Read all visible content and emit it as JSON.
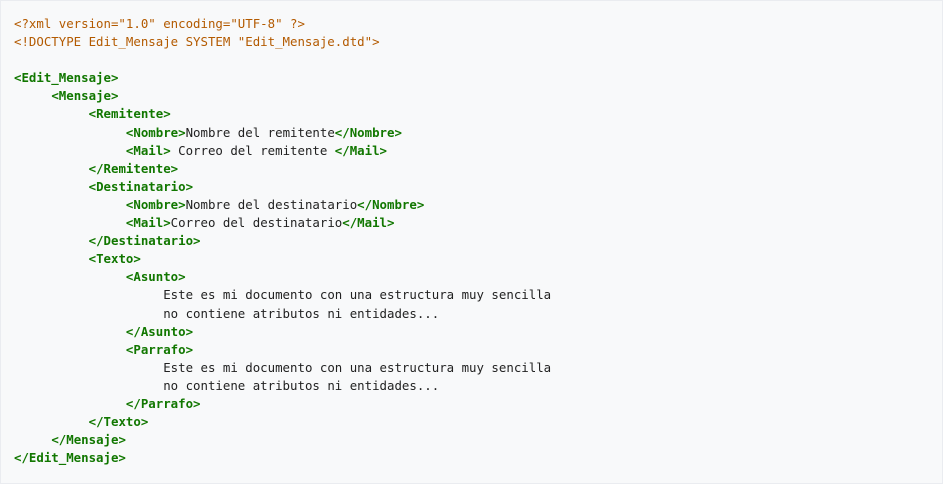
{
  "lines": [
    {
      "indent": 0,
      "parts": [
        {
          "t": "decl",
          "v": "<?xml version=\"1.0\" encoding=\"UTF-8\" ?>"
        }
      ]
    },
    {
      "indent": 0,
      "parts": [
        {
          "t": "decl",
          "v": "<!DOCTYPE Edit_Mensaje SYSTEM \"Edit_Mensaje.dtd\">"
        }
      ]
    },
    {
      "indent": 0,
      "parts": []
    },
    {
      "indent": 0,
      "parts": [
        {
          "t": "tag",
          "v": "<Edit_Mensaje>"
        }
      ]
    },
    {
      "indent": 1,
      "parts": [
        {
          "t": "tag",
          "v": "<Mensaje>"
        }
      ]
    },
    {
      "indent": 2,
      "parts": [
        {
          "t": "tag",
          "v": "<Remitente>"
        }
      ]
    },
    {
      "indent": 3,
      "parts": [
        {
          "t": "tag",
          "v": "<Nombre>"
        },
        {
          "t": "txt",
          "v": "Nombre del remitente"
        },
        {
          "t": "tag",
          "v": "</Nombre>"
        }
      ]
    },
    {
      "indent": 3,
      "parts": [
        {
          "t": "tag",
          "v": "<Mail>"
        },
        {
          "t": "txt",
          "v": " Correo del remitente "
        },
        {
          "t": "tag",
          "v": "</Mail>"
        }
      ]
    },
    {
      "indent": 2,
      "parts": [
        {
          "t": "tag",
          "v": "</Remitente>"
        }
      ]
    },
    {
      "indent": 2,
      "parts": [
        {
          "t": "tag",
          "v": "<Destinatario>"
        }
      ]
    },
    {
      "indent": 3,
      "parts": [
        {
          "t": "tag",
          "v": "<Nombre>"
        },
        {
          "t": "txt",
          "v": "Nombre del destinatario"
        },
        {
          "t": "tag",
          "v": "</Nombre>"
        }
      ]
    },
    {
      "indent": 3,
      "parts": [
        {
          "t": "tag",
          "v": "<Mail>"
        },
        {
          "t": "txt",
          "v": "Correo del destinatario"
        },
        {
          "t": "tag",
          "v": "</Mail>"
        }
      ]
    },
    {
      "indent": 2,
      "parts": [
        {
          "t": "tag",
          "v": "</Destinatario>"
        }
      ]
    },
    {
      "indent": 2,
      "parts": [
        {
          "t": "tag",
          "v": "<Texto>"
        }
      ]
    },
    {
      "indent": 3,
      "parts": [
        {
          "t": "tag",
          "v": "<Asunto>"
        }
      ]
    },
    {
      "indent": 4,
      "parts": [
        {
          "t": "txt",
          "v": "Este es mi documento con una estructura muy sencilla"
        }
      ]
    },
    {
      "indent": 4,
      "parts": [
        {
          "t": "txt",
          "v": "no contiene atributos ni entidades..."
        }
      ]
    },
    {
      "indent": 3,
      "parts": [
        {
          "t": "tag",
          "v": "</Asunto>"
        }
      ]
    },
    {
      "indent": 3,
      "parts": [
        {
          "t": "tag",
          "v": "<Parrafo>"
        }
      ]
    },
    {
      "indent": 4,
      "parts": [
        {
          "t": "txt",
          "v": "Este es mi documento con una estructura muy sencilla"
        }
      ]
    },
    {
      "indent": 4,
      "parts": [
        {
          "t": "txt",
          "v": "no contiene atributos ni entidades..."
        }
      ]
    },
    {
      "indent": 3,
      "parts": [
        {
          "t": "tag",
          "v": "</Parrafo>"
        }
      ]
    },
    {
      "indent": 2,
      "parts": [
        {
          "t": "tag",
          "v": "</Texto>"
        }
      ]
    },
    {
      "indent": 1,
      "parts": [
        {
          "t": "tag",
          "v": "</Mensaje>"
        }
      ]
    },
    {
      "indent": 0,
      "parts": [
        {
          "t": "tag",
          "v": "</Edit_Mensaje>"
        }
      ]
    }
  ]
}
